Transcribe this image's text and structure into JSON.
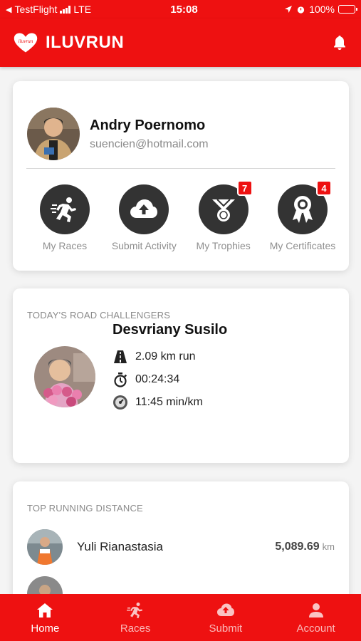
{
  "status_bar": {
    "back_app": "TestFlight",
    "network": "LTE",
    "time": "15:08",
    "battery": "100%"
  },
  "app": {
    "title": "ILUVRUN",
    "logo_text": "iluvrun",
    "accent_color": "#ee1111"
  },
  "profile": {
    "name": "Andry Poernomo",
    "email": "suencien@hotmail.com",
    "actions": [
      {
        "label": "My Races",
        "icon": "runner-icon",
        "badge": ""
      },
      {
        "label": "Submit Activity",
        "icon": "cloud-upload-icon",
        "badge": ""
      },
      {
        "label": "My Trophies",
        "icon": "trophy-medal-icon",
        "badge": "7"
      },
      {
        "label": "My Certificates",
        "icon": "certificate-ribbon-icon",
        "badge": "4"
      }
    ]
  },
  "challengers": {
    "section_title": "TODAY'S ROAD CHALLENGERS",
    "name": "Desvriany Susilo",
    "distance": "2.09 km run",
    "duration": "00:24:34",
    "pace": "11:45 min/km"
  },
  "top_distance": {
    "section_title": "TOP RUNNING DISTANCE",
    "rows": [
      {
        "name": "Yuli Rianastasia",
        "value": "5,089.69",
        "unit": "km"
      }
    ]
  },
  "bottom_nav": [
    {
      "label": "Home",
      "icon": "home-icon",
      "active": true
    },
    {
      "label": "Races",
      "icon": "runner-icon",
      "active": false
    },
    {
      "label": "Submit",
      "icon": "cloud-upload-icon",
      "active": false
    },
    {
      "label": "Account",
      "icon": "person-icon",
      "active": false
    }
  ]
}
